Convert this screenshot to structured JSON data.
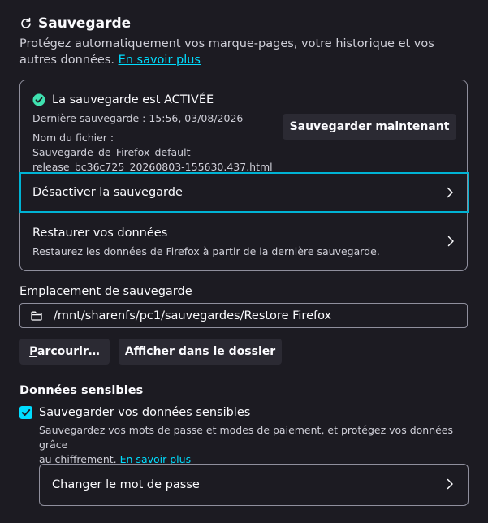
{
  "header": {
    "title": "Sauvegarde",
    "icon": "refresh-icon",
    "description": "Protégez automatiquement vos marque-pages, votre historique et vos autres données.",
    "learn_more": "En savoir plus"
  },
  "status": {
    "text": "La sauvegarde est ACTIVÉE",
    "icon": "check-circle-icon",
    "icon_color": "#3fe1b0",
    "last_backup": "Dernière sauvegarde : 15:56, 03/08/2026",
    "file_name_line1": "Nom du fichier : Sauvegarde_de_Firefox_default-",
    "file_name_line2": "release_bc36c725_20260803-155630.437.html",
    "backup_now_label": "Sauvegarder maintenant"
  },
  "rows": {
    "disable_label": "Désactiver la sauvegarde",
    "restore_label": "Restaurer vos données",
    "restore_sub": "Restaurez les données de Firefox à partir de la dernière sauvegarde."
  },
  "location": {
    "label": "Emplacement de sauvegarde",
    "path": "/mnt/sharenfs/pc1/sauvegardes/Restore Firefox",
    "browse_first": "P",
    "browse_rest": "arcourir…",
    "show_folder_label": "Afficher dans le dossier"
  },
  "sensitive": {
    "title": "Données sensibles",
    "checkbox_label": "Sauvegarder vos données sensibles",
    "checked": true,
    "desc_line1": "Sauvegardez vos mots de passe et modes de paiement, et protégez vos données grâce",
    "desc_line2": "au chiffrement.",
    "learn_more": "En savoir plus",
    "change_password_label": "Changer le mot de passe"
  },
  "colors": {
    "background": "#1c1b22",
    "accent": "#00ddff",
    "focus_border": "#00b3d4",
    "button_bg": "#2b2a33"
  }
}
